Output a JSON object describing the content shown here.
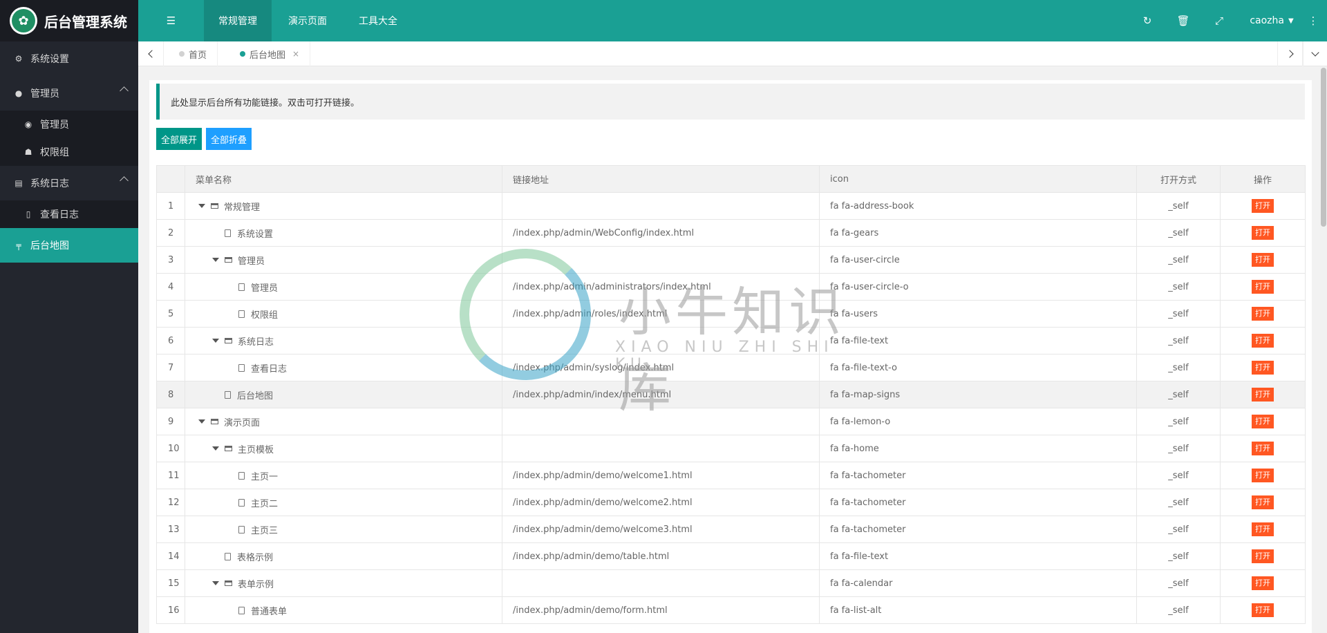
{
  "app": {
    "title": "后台管理系统"
  },
  "header": {
    "menu_icon": "indent-icon",
    "nav": [
      {
        "label": "常规管理"
      },
      {
        "label": "演示页面"
      },
      {
        "label": "工具大全"
      }
    ],
    "user": "caozha"
  },
  "sidebar": {
    "items": [
      {
        "label": "系统设置",
        "icon": "gears-icon"
      },
      {
        "label": "管理员",
        "icon": "user-circle-icon"
      },
      {
        "label": "管理员",
        "icon": "user-circle-o-icon"
      },
      {
        "label": "权限组",
        "icon": "users-icon"
      },
      {
        "label": "系统日志",
        "icon": "file-text-icon"
      },
      {
        "label": "查看日志",
        "icon": "file-text-o-icon"
      },
      {
        "label": "后台地图",
        "icon": "map-signs-icon"
      }
    ]
  },
  "tabs": [
    {
      "label": "首页"
    },
    {
      "label": "后台地图",
      "close": "×"
    }
  ],
  "notice": "此处显示后台所有功能链接。双击可打开链接。",
  "buttons": {
    "expand_all": "全部展开",
    "collapse_all": "全部折叠"
  },
  "table": {
    "columns": [
      "",
      "菜单名称",
      "链接地址",
      "icon",
      "打开方式",
      "操作"
    ],
    "action_label": "打开",
    "rows": [
      {
        "id": "1",
        "name": "常规管理",
        "url": "",
        "icon": "fa fa-address-book",
        "target": "_self"
      },
      {
        "id": "2",
        "name": "系统设置",
        "url": "/index.php/admin/WebConfig/index.html",
        "icon": "fa fa-gears",
        "target": "_self"
      },
      {
        "id": "3",
        "name": "管理员",
        "url": "",
        "icon": "fa fa-user-circle",
        "target": "_self"
      },
      {
        "id": "4",
        "name": "管理员",
        "url": "/index.php/admin/administrators/index.html",
        "icon": "fa fa-user-circle-o",
        "target": "_self"
      },
      {
        "id": "5",
        "name": "权限组",
        "url": "/index.php/admin/roles/index.html",
        "icon": "fa fa-users",
        "target": "_self"
      },
      {
        "id": "6",
        "name": "系统日志",
        "url": "",
        "icon": "fa fa-file-text",
        "target": "_self"
      },
      {
        "id": "7",
        "name": "查看日志",
        "url": "/index.php/admin/syslog/index.html",
        "icon": "fa fa-file-text-o",
        "target": "_self"
      },
      {
        "id": "8",
        "name": "后台地图",
        "url": "/index.php/admin/index/menu.html",
        "icon": "fa fa-map-signs",
        "target": "_self"
      },
      {
        "id": "9",
        "name": "演示页面",
        "url": "",
        "icon": "fa fa-lemon-o",
        "target": "_self"
      },
      {
        "id": "10",
        "name": "主页模板",
        "url": "",
        "icon": "fa fa-home",
        "target": "_self"
      },
      {
        "id": "11",
        "name": "主页一",
        "url": "/index.php/admin/demo/welcome1.html",
        "icon": "fa fa-tachometer",
        "target": "_self"
      },
      {
        "id": "12",
        "name": "主页二",
        "url": "/index.php/admin/demo/welcome2.html",
        "icon": "fa fa-tachometer",
        "target": "_self"
      },
      {
        "id": "13",
        "name": "主页三",
        "url": "/index.php/admin/demo/welcome3.html",
        "icon": "fa fa-tachometer",
        "target": "_self"
      },
      {
        "id": "14",
        "name": "表格示例",
        "url": "/index.php/admin/demo/table.html",
        "icon": "fa fa-file-text",
        "target": "_self"
      },
      {
        "id": "15",
        "name": "表单示例",
        "url": "",
        "icon": "fa fa-calendar",
        "target": "_self"
      },
      {
        "id": "16",
        "name": "普通表单",
        "url": "/index.php/admin/demo/form.html",
        "icon": "fa fa-list-alt",
        "target": "_self"
      }
    ]
  },
  "watermark": {
    "cn": "小牛知识库",
    "en": "XIAO NIU ZHI SHI KU"
  },
  "colors": {
    "primary": "#1aa094",
    "sidebar": "#23262e",
    "danger": "#ff5722",
    "blue": "#1e9fff"
  }
}
